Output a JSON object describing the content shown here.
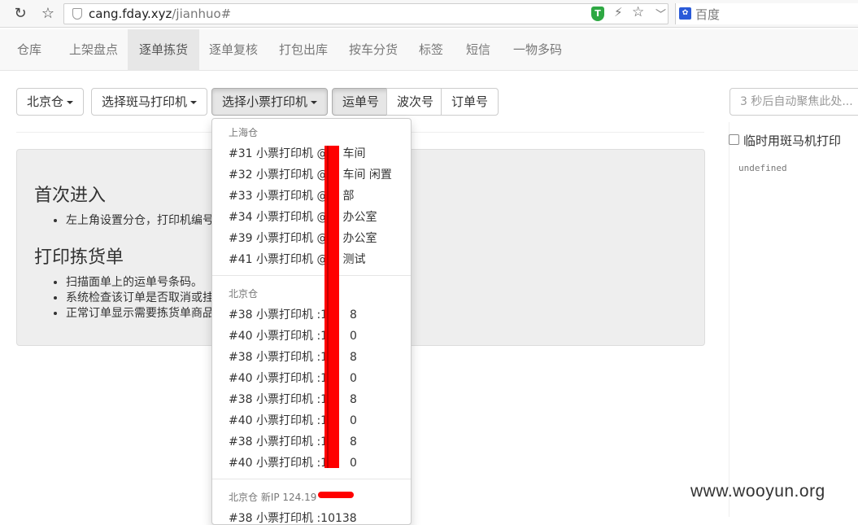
{
  "browser": {
    "url_host": "cang.fday.xyz",
    "url_path": "/jianhuo#",
    "search_engine": "百度",
    "extension_badge": "T"
  },
  "nav": {
    "items": [
      "仓库",
      "上架盘点",
      "逐单拣货",
      "逐单复核",
      "打包出库",
      "按车分货",
      "标签",
      "短信",
      "一物多码"
    ],
    "active": "逐单拣货"
  },
  "toolbar": {
    "warehouse": "北京仓",
    "zebra_printer": "选择斑马打印机",
    "ticket_printer": "选择小票打印机",
    "modes": [
      "运单号",
      "波次号",
      "订单号"
    ],
    "active_mode": "运单号",
    "focus_placeholder": "3 秒后自动聚焦此处..."
  },
  "side": {
    "temp_zebra_label": "临时用斑马机打印",
    "debug_output": "undefined"
  },
  "help": {
    "section1_title": "首次进入",
    "section1_items": [
      "左上角设置分仓，打印机编号"
    ],
    "section2_title": "打印拣货单",
    "section2_items": [
      "扫描面单上的运单号条码。",
      "系统检查该订单是否取消或挂",
      "正常订单显示需要拣货单商品"
    ]
  },
  "dropdown": {
    "groups": [
      {
        "header": "上海仓",
        "items": [
          "#31 小票打印机 @",
          "#32 小票打印机 @",
          "#33 小票打印机 @",
          "#34 小票打印机 @",
          "#39 小票打印机 @",
          "#41 小票打印机 @"
        ],
        "suffixes": [
          "车间",
          "车间 闲置",
          "部",
          "办公室",
          "办公室",
          "测试"
        ]
      },
      {
        "header": "北京仓",
        "items": [
          "#38 小票打印机 :10",
          "#40 小票打印机 :10",
          "#38 小票打印机 :10",
          "#40 小票打印机 :10",
          "#38 小票打印机 :10",
          "#40 小票打印机 :10",
          "#38 小票打印机 :10",
          "#40 小票打印机 :10"
        ],
        "suffixes": [
          "8",
          "0",
          "8",
          "0",
          "8",
          "0",
          "8",
          "0"
        ]
      },
      {
        "header": "北京仓 新IP 124.19",
        "items": [
          "#38 小票打印机 :10138"
        ],
        "suffixes": [
          ""
        ]
      }
    ]
  },
  "watermark": "www.wooyun.org"
}
